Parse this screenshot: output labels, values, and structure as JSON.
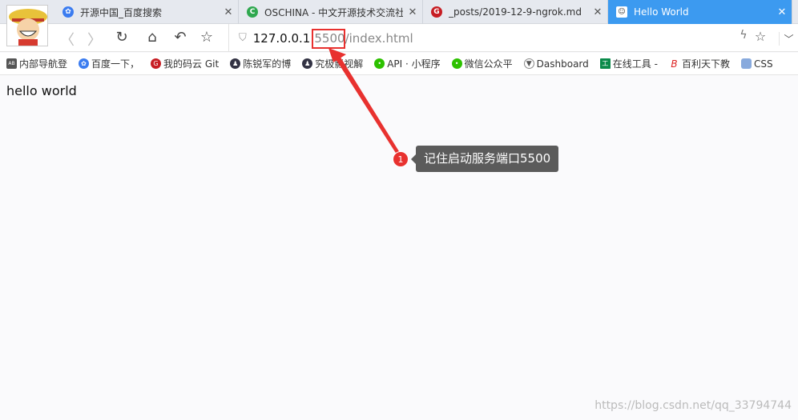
{
  "tabs": [
    {
      "label": "开源中国_百度搜索",
      "icon": "baidu-paw-icon",
      "color": "#3b7cf0"
    },
    {
      "label": "OSCHINA - 中文开源技术交流社区",
      "icon": "oschina-icon",
      "color": "#2fa84f"
    },
    {
      "label": "_posts/2019-12-9-ngrok.md",
      "icon": "gitee-icon",
      "color": "#c71d23"
    },
    {
      "label": "Hello World",
      "icon": "page-avatar-icon",
      "active": true
    }
  ],
  "close_glyph": "✕",
  "address": {
    "host": "127.0.0.1:",
    "port": "5500",
    "path": "/index.html"
  },
  "bookmarks": [
    {
      "label": "内部导航登",
      "icon": "nav-icon"
    },
    {
      "label": "百度一下，",
      "icon": "baidu-paw-icon"
    },
    {
      "label": "我的码云 Git",
      "icon": "gitee-icon"
    },
    {
      "label": "陈锐军的博",
      "icon": "person-icon"
    },
    {
      "label": "究极影视解",
      "icon": "person-icon"
    },
    {
      "label": "API · 小程序",
      "icon": "wechat-icon"
    },
    {
      "label": "微信公众平",
      "icon": "wechat-icon"
    },
    {
      "label": "Dashboard",
      "icon": "fox-icon"
    },
    {
      "label": "在线工具 -",
      "icon": "tool-icon"
    },
    {
      "label": "百利天下教",
      "icon": "b-icon"
    },
    {
      "label": "CSS",
      "icon": "css-icon"
    }
  ],
  "page": {
    "text": "hello world"
  },
  "annotation": {
    "number": "1",
    "text": "记住启动服务端口5500",
    "color": "#e8312f"
  },
  "watermark": "https://blog.csdn.net/qq_33794744",
  "accent": "#3c9af0"
}
